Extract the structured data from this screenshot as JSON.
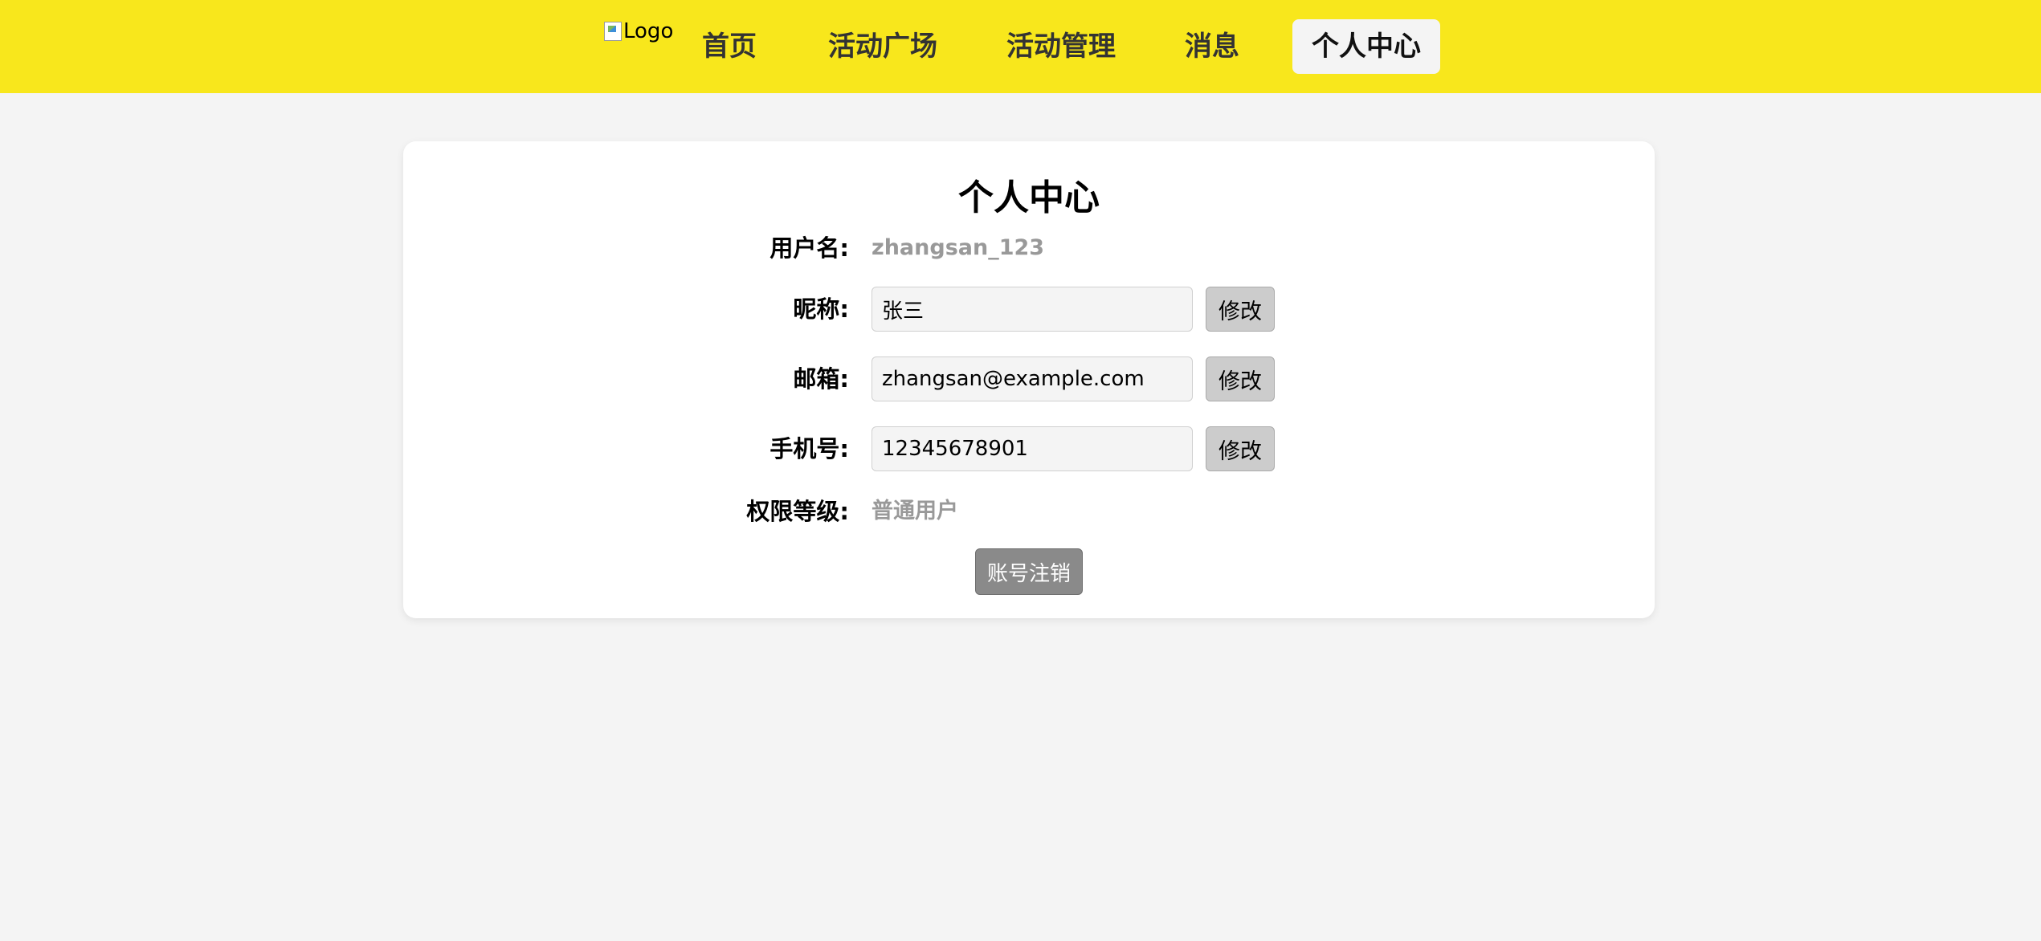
{
  "header": {
    "logo_alt": "Logo",
    "nav": [
      {
        "label": "首页"
      },
      {
        "label": "活动广场"
      },
      {
        "label": "活动管理"
      },
      {
        "label": "消息"
      },
      {
        "label": "个人中心",
        "active": true
      }
    ],
    "background_color": "#f8e71c"
  },
  "profile": {
    "title": "个人中心",
    "username": {
      "label": "用户名:",
      "value": "zhangsan_123"
    },
    "nickname": {
      "label": "昵称:",
      "value": "张三",
      "button": "修改"
    },
    "email": {
      "label": "邮箱:",
      "value": "zhangsan@example.com",
      "button": "修改"
    },
    "phone": {
      "label": "手机号:",
      "value": "12345678901",
      "button": "修改"
    },
    "level": {
      "label": "权限等级:",
      "value": "普通用户"
    },
    "delete_button": "账号注销"
  }
}
